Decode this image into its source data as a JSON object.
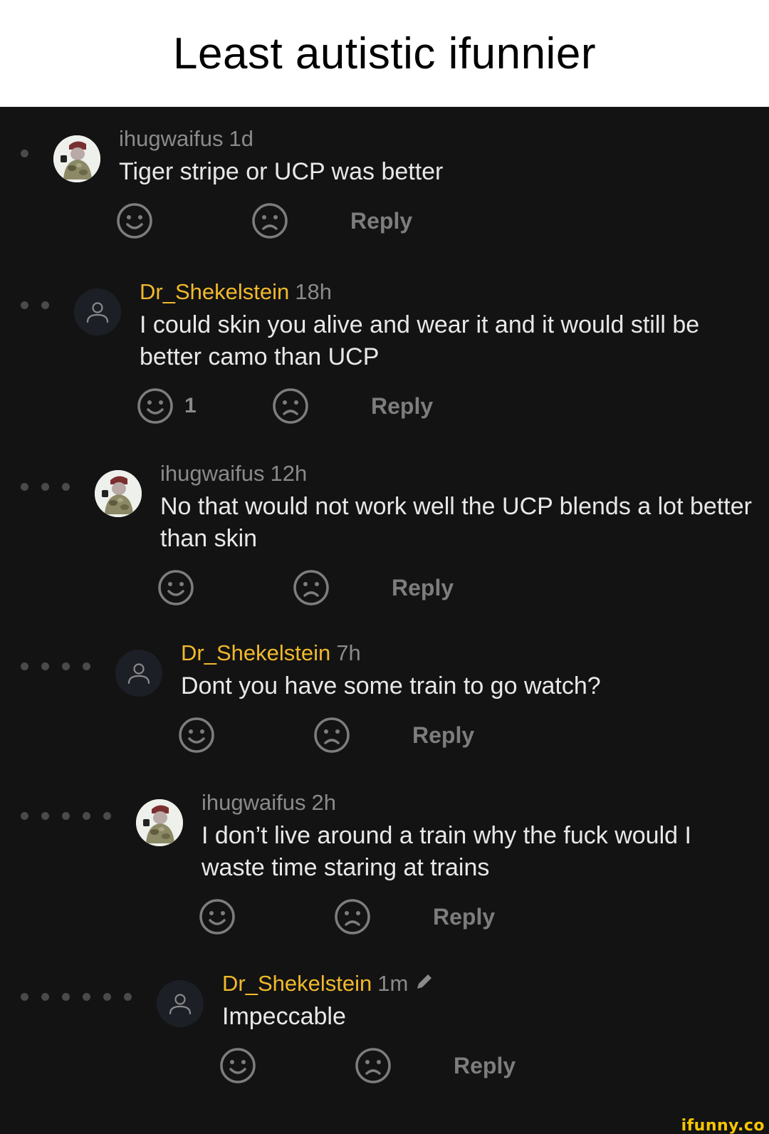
{
  "caption": "Least autistic ifunnier",
  "watermark": "ifunny.co",
  "colors": {
    "background": "#131313",
    "username_gold": "#f1b92c",
    "username_gray": "#8a8a8a",
    "text": "#e8e8e8",
    "icon": "#7d7d7d"
  },
  "comments": [
    {
      "username": "ihugwaifus",
      "time": "1d",
      "text": "Tiger stripe or UCP was better",
      "depth": 1,
      "avatar": "photo",
      "username_style": "gray",
      "smile_count": "",
      "reply_label": "Reply"
    },
    {
      "username": "Dr_Shekelstein",
      "time": "18h",
      "text": "I could skin you alive and wear it and it would still be better camo than UCP",
      "depth": 2,
      "avatar": "generic",
      "username_style": "gold",
      "smile_count": "1",
      "reply_label": "Reply"
    },
    {
      "username": "ihugwaifus",
      "time": "12h",
      "text": "No that would not work well the UCP blends a lot better than skin",
      "depth": 3,
      "avatar": "photo",
      "username_style": "gray",
      "smile_count": "",
      "reply_label": "Reply"
    },
    {
      "username": "Dr_Shekelstein",
      "time": "7h",
      "text": "Dont you have some train to go watch?",
      "depth": 4,
      "avatar": "generic",
      "username_style": "gold",
      "smile_count": "",
      "reply_label": "Reply"
    },
    {
      "username": "ihugwaifus",
      "time": "2h",
      "text": "I don’t live around a train why the fuck would I waste time staring at trains",
      "depth": 5,
      "avatar": "photo",
      "username_style": "gray",
      "smile_count": "",
      "reply_label": "Reply"
    },
    {
      "username": "Dr_Shekelstein",
      "time": "1m",
      "text": "Impeccable",
      "depth": 6,
      "avatar": "generic",
      "username_style": "gold",
      "edited": true,
      "smile_count": "",
      "reply_label": "Reply"
    }
  ]
}
